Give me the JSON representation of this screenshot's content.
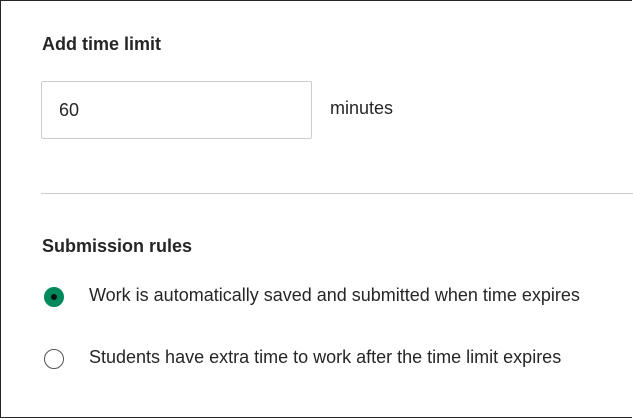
{
  "time_limit": {
    "heading": "Add time limit",
    "value": "60",
    "unit": "minutes"
  },
  "submission_rules": {
    "heading": "Submission rules",
    "options": [
      {
        "label": "Work is automatically saved and submitted when time expires",
        "selected": true
      },
      {
        "label": "Students have extra time to work after the time limit expires",
        "selected": false
      }
    ]
  },
  "colors": {
    "accent": "#008a5b",
    "text": "#262626",
    "border": "#cdcdcd"
  }
}
